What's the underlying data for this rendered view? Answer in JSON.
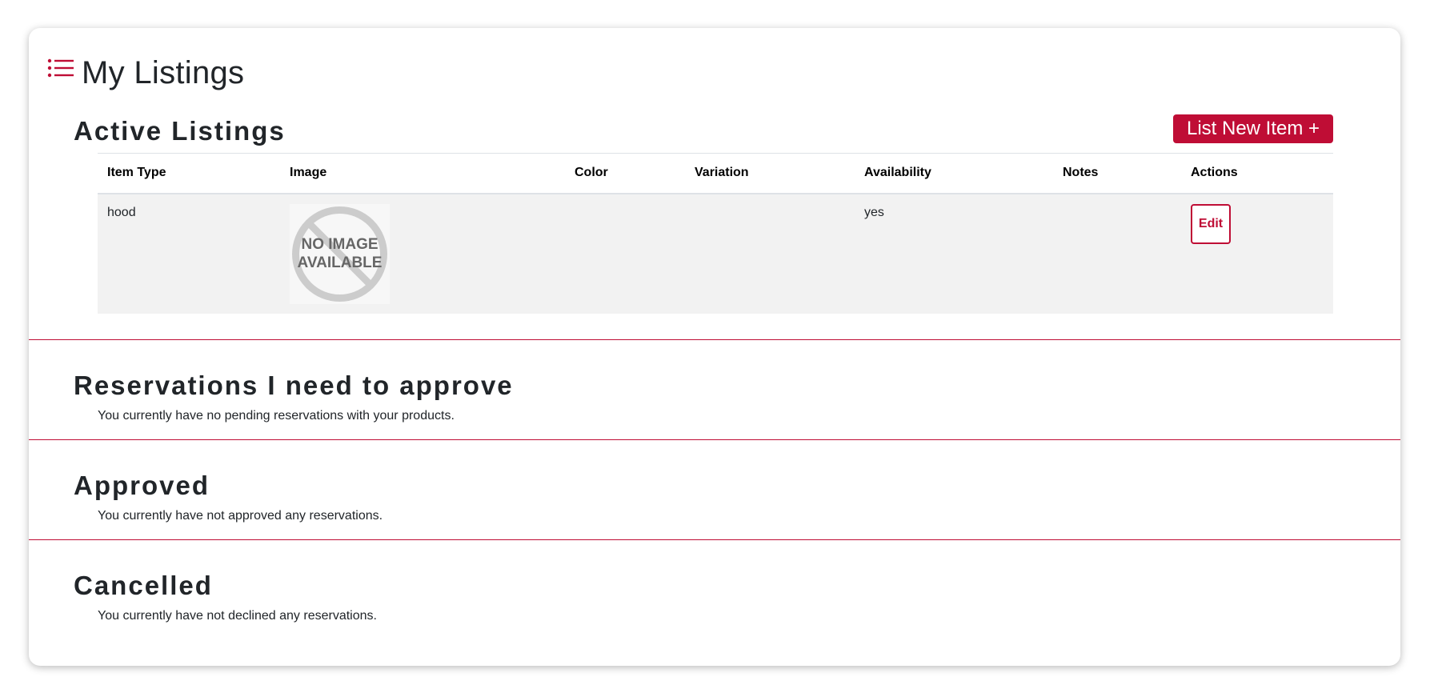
{
  "page": {
    "title": "My Listings"
  },
  "active_listings": {
    "title": "Active Listings",
    "new_item_button": "List New Item +",
    "columns": [
      "Item Type",
      "Image",
      "Color",
      "Variation",
      "Availability",
      "Notes",
      "Actions"
    ],
    "rows": [
      {
        "item_type": "hood",
        "image_text_line1": "NO IMAGE",
        "image_text_line2": "AVAILABLE",
        "color": "",
        "variation": "",
        "availability": "yes",
        "notes": "",
        "action_label": "Edit"
      }
    ]
  },
  "reservations_pending": {
    "title": "Reservations I need to approve",
    "message": "You currently have no pending reservations with your products."
  },
  "approved": {
    "title": "Approved",
    "message": "You currently have not approved any reservations."
  },
  "cancelled": {
    "title": "Cancelled",
    "message": "You currently have not declined any reservations."
  },
  "colors": {
    "accent": "#bf0d35",
    "text": "#212529",
    "row_bg": "#f2f2f2"
  },
  "icons": {
    "header": "list-icon",
    "placeholder": "no-image-icon"
  }
}
